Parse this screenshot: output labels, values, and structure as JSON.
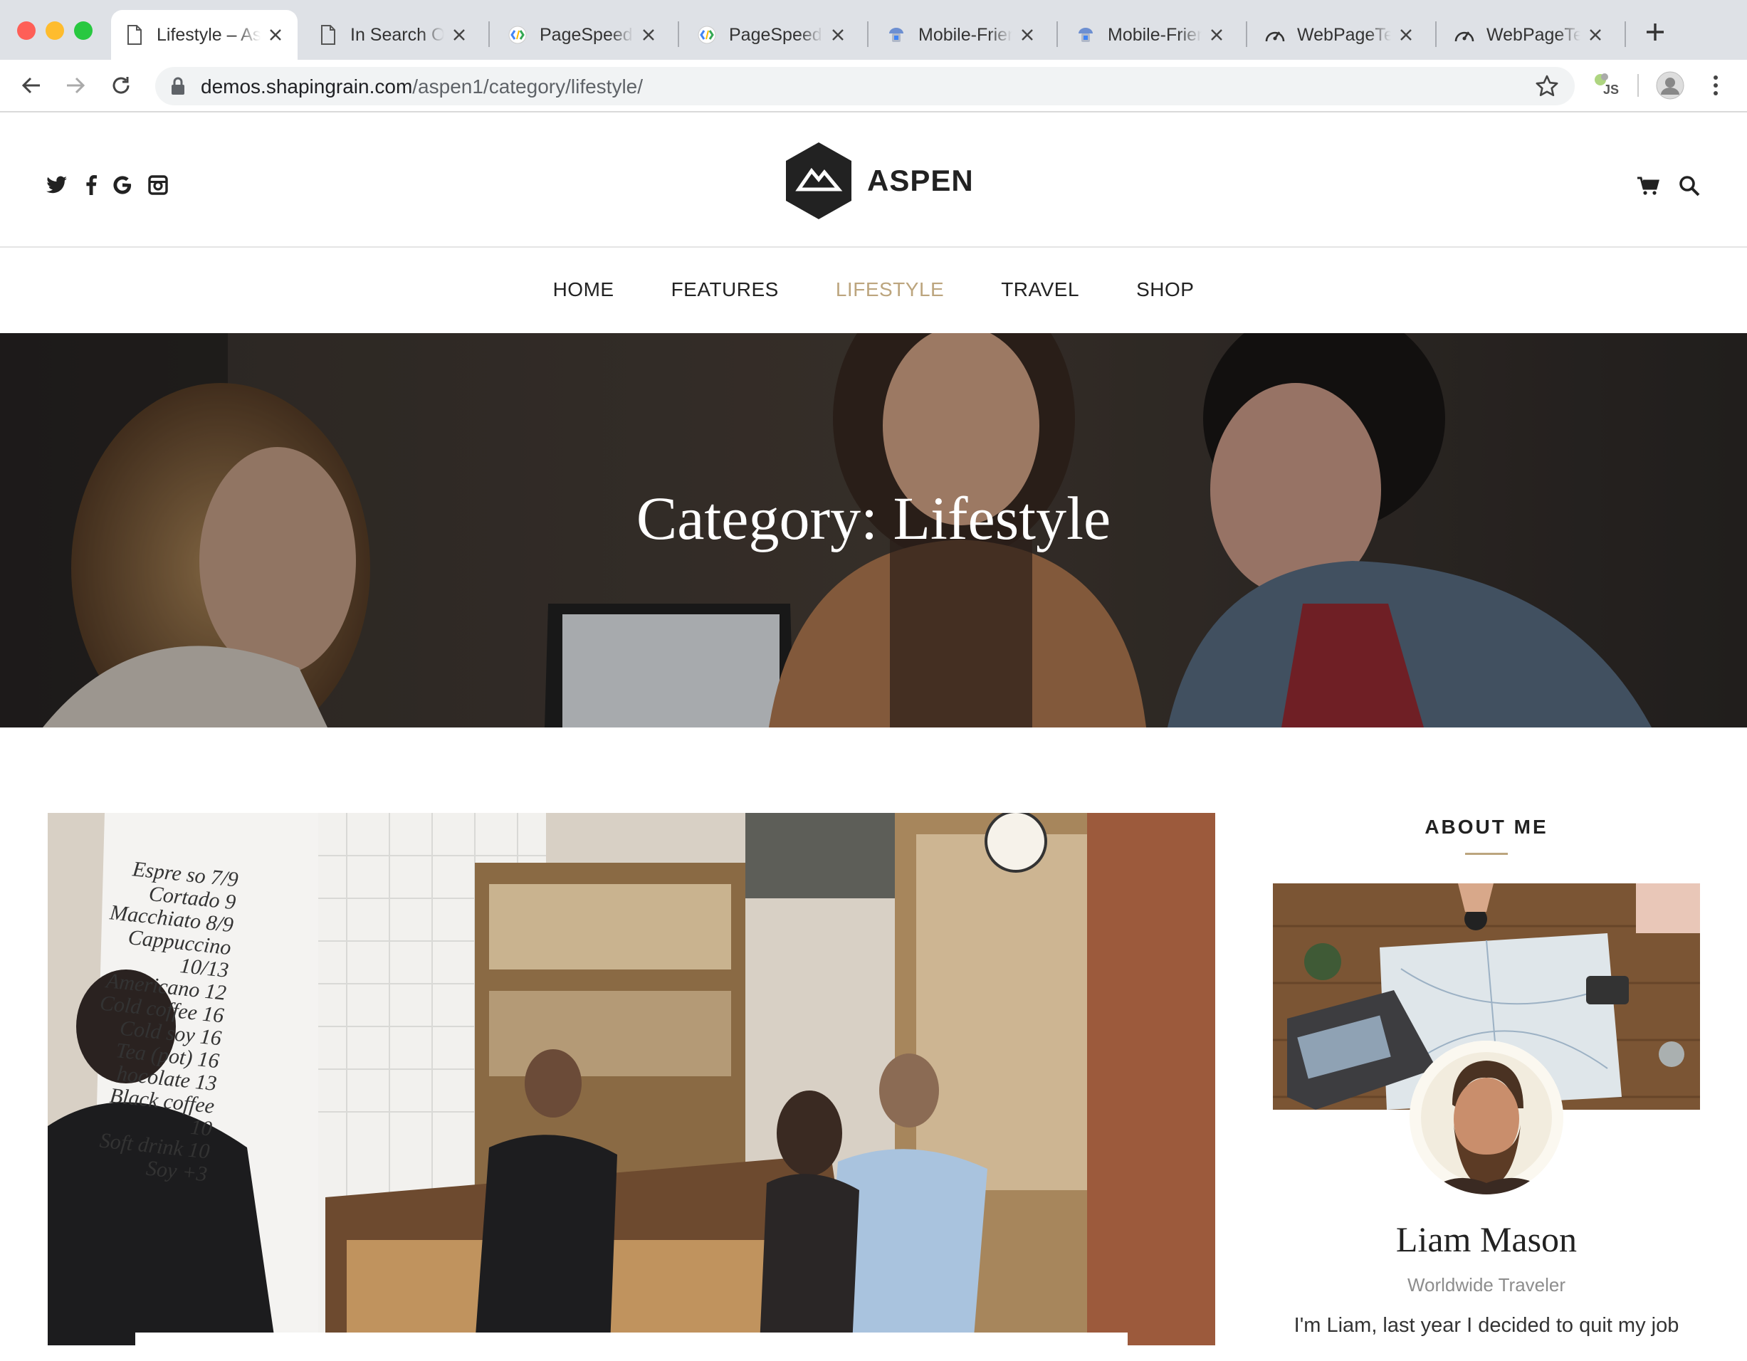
{
  "browser": {
    "tabs": [
      {
        "title": "Lifestyle – Aspen",
        "icon": "document-icon",
        "active": true
      },
      {
        "title": "In Search Of Speed",
        "icon": "document-icon",
        "active": false
      },
      {
        "title": "PageSpeed Insights",
        "icon": "pagespeed-icon",
        "active": false
      },
      {
        "title": "PageSpeed Insights",
        "icon": "pagespeed-icon",
        "active": false
      },
      {
        "title": "Mobile-Friendly Test",
        "icon": "mobile-friendly-icon",
        "active": false
      },
      {
        "title": "Mobile-Friendly Test",
        "icon": "mobile-friendly-icon",
        "active": false
      },
      {
        "title": "WebPageTest",
        "icon": "webpagetest-icon",
        "active": false
      },
      {
        "title": "WebPageTest",
        "icon": "webpagetest-icon",
        "active": false
      }
    ],
    "url_host": "demos.shapingrain.com",
    "url_path": "/aspen1/category/lifestyle/",
    "extension_label": "JS"
  },
  "site": {
    "logo_text": "ASPEN",
    "social": [
      "twitter-icon",
      "facebook-icon",
      "google-icon",
      "instagram-icon"
    ],
    "nav": [
      {
        "label": "HOME",
        "current": false
      },
      {
        "label": "FEATURES",
        "current": false
      },
      {
        "label": "LIFESTYLE",
        "current": true
      },
      {
        "label": "TRAVEL",
        "current": false
      },
      {
        "label": "SHOP",
        "current": false
      }
    ],
    "hero_title": "Category: Lifestyle",
    "accent_color": "#bca57e",
    "cafe_menu": [
      "Espre so 7/9",
      "Cortado 9",
      "Macchiato 8/9",
      "Cappuccino 10/13",
      "Americano 12",
      "Cold coffee 16",
      "Cold soy 16",
      "Tea (pot) 16",
      "hocolate 13",
      "Black coffee 10",
      "Soft drink 10",
      "Soy +3"
    ]
  },
  "sidebar": {
    "about_title": "ABOUT ME",
    "name": "Liam Mason",
    "role": "Worldwide Traveler",
    "text": "I'm Liam, last year I decided to quit my job"
  }
}
